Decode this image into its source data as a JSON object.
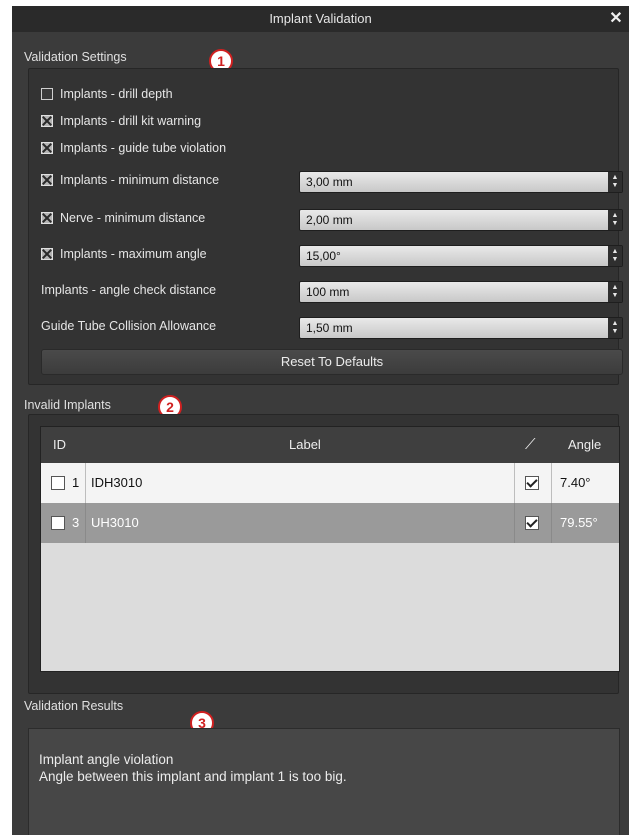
{
  "window": {
    "title": "Implant Validation"
  },
  "settings": {
    "title": "Validation Settings",
    "marker": "1",
    "checks": [
      {
        "label": "Implants - drill depth",
        "checked": false
      },
      {
        "label": "Implants - drill kit warning",
        "checked": true
      },
      {
        "label": "Implants - guide tube violation",
        "checked": true
      }
    ],
    "spinrows": [
      {
        "label": "Implants - minimum distance",
        "checked": true,
        "value": "3,00 mm"
      },
      {
        "label": "Nerve - minimum distance",
        "checked": true,
        "value": "2,00 mm"
      },
      {
        "label": "Implants - maximum angle",
        "checked": true,
        "value": "15,00°"
      },
      {
        "label": "Implants - angle check distance",
        "value": "100 mm"
      },
      {
        "label": "Guide Tube Collision Allowance",
        "value": "1,50 mm"
      }
    ],
    "reset_label": "Reset To Defaults"
  },
  "invalid": {
    "title": "Invalid Implants",
    "marker": "2",
    "columns": {
      "id": "ID",
      "label": "Label",
      "angle": "Angle"
    },
    "rows": [
      {
        "id": "1",
        "label": "IDH3010",
        "checked": true,
        "angle": "7.40°"
      },
      {
        "id": "3",
        "label": "UH3010",
        "checked": true,
        "angle": "79.55°"
      }
    ]
  },
  "results": {
    "title": "Validation Results",
    "marker": "3",
    "line1": "Implant angle violation",
    "line2": "Angle between this implant and implant 1 is too big."
  }
}
